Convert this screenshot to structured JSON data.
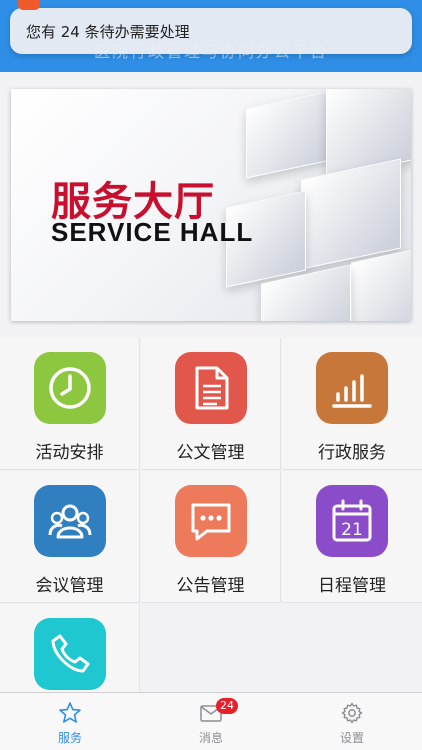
{
  "notification": {
    "text": "您有 24 条待办需要处理"
  },
  "header": {
    "title": "医院行政管理与协同办公平台"
  },
  "banner": {
    "title_cn": "服务大厅",
    "title_en": "SERVICE HALL"
  },
  "grid": {
    "items": [
      {
        "label": "活动安排",
        "icon": "clock-icon",
        "color": "#8dc63f"
      },
      {
        "label": "公文管理",
        "icon": "document-icon",
        "color": "#e2574c"
      },
      {
        "label": "行政服务",
        "icon": "bar-chart-icon",
        "color": "#c8773b"
      },
      {
        "label": "会议管理",
        "icon": "people-icon",
        "color": "#2f7fc1"
      },
      {
        "label": "公告管理",
        "icon": "chat-bubble-icon",
        "color": "#ee7a5c"
      },
      {
        "label": "日程管理",
        "icon": "calendar-icon",
        "color": "#8a4cc9"
      },
      {
        "label": "",
        "icon": "phone-icon",
        "color": "#1fc7d0"
      }
    ],
    "calendar_day": "21"
  },
  "tabbar": {
    "items": [
      {
        "label": "服务",
        "icon": "star-icon",
        "active": true
      },
      {
        "label": "消息",
        "icon": "mail-icon",
        "badge": "24"
      },
      {
        "label": "设置",
        "icon": "gear-icon"
      }
    ]
  },
  "colors": {
    "primary": "#2f8ee6",
    "badge": "#e6202a",
    "banner_red": "#c8102e"
  }
}
